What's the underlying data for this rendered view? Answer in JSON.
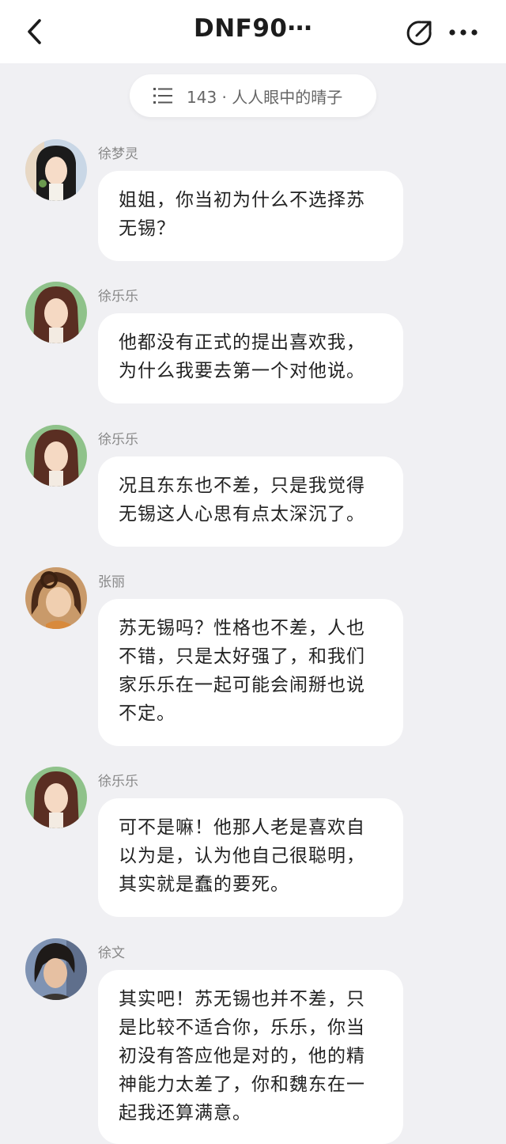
{
  "header": {
    "title": "DNF90⋯",
    "back_icon": "chevron-left-icon",
    "share_icon": "share-icon",
    "more_icon": "more-dots-icon"
  },
  "chapter": {
    "label": "143 · 人人眼中的晴子",
    "icon": "list-icon"
  },
  "messages": [
    {
      "speaker": "徐梦灵",
      "avatar": "avatar-long-black-hair",
      "lines": [
        "姐姐，你当初为什么不选择苏",
        "无锡？"
      ]
    },
    {
      "speaker": "徐乐乐",
      "avatar": "avatar-brown-hair-girl",
      "lines": [
        "他都没有正式的提出喜欢我，",
        "为什么我要去第一个对他说。"
      ]
    },
    {
      "speaker": "徐乐乐",
      "avatar": "avatar-brown-hair-girl",
      "lines": [
        "况且东东也不差，只是我觉得",
        "无锡这人心思有点太深沉了。"
      ]
    },
    {
      "speaker": "张丽",
      "avatar": "avatar-curly-hair-woman",
      "lines": [
        "苏无锡吗？性格也不差，人也",
        "不错，只是太好强了，和我们",
        "家乐乐在一起可能会闹掰也说",
        "不定。"
      ]
    },
    {
      "speaker": "徐乐乐",
      "avatar": "avatar-brown-hair-girl",
      "lines": [
        "可不是嘛！他那人老是喜欢自",
        "以为是，认为他自己很聪明，",
        "其实就是蠢的要死。"
      ]
    },
    {
      "speaker": "徐文",
      "avatar": "avatar-dark-hair-man",
      "lines": [
        "其实吧！苏无锡也并不差，只",
        "是比较不适合你，乐乐，你当",
        "初没有答应他是对的，他的精",
        "神能力太差了，你和魏东在一",
        "起我还算满意。"
      ]
    }
  ]
}
